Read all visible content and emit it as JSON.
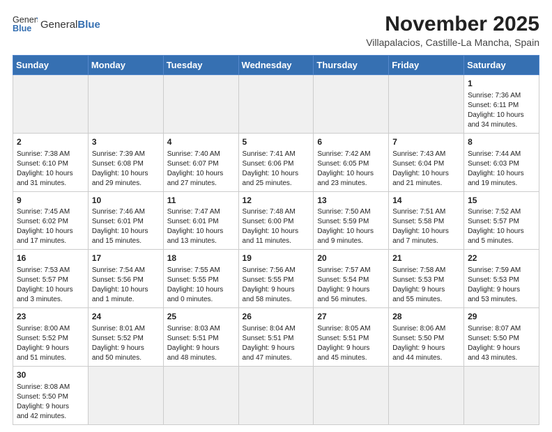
{
  "header": {
    "logo_general": "General",
    "logo_blue": "Blue",
    "month_title": "November 2025",
    "location": "Villapalacios, Castille-La Mancha, Spain"
  },
  "weekdays": [
    "Sunday",
    "Monday",
    "Tuesday",
    "Wednesday",
    "Thursday",
    "Friday",
    "Saturday"
  ],
  "weeks": [
    [
      {
        "day": "",
        "info": "",
        "empty": true
      },
      {
        "day": "",
        "info": "",
        "empty": true
      },
      {
        "day": "",
        "info": "",
        "empty": true
      },
      {
        "day": "",
        "info": "",
        "empty": true
      },
      {
        "day": "",
        "info": "",
        "empty": true
      },
      {
        "day": "",
        "info": "",
        "empty": true
      },
      {
        "day": "1",
        "info": "Sunrise: 7:36 AM\nSunset: 6:11 PM\nDaylight: 10 hours\nand 34 minutes."
      }
    ],
    [
      {
        "day": "2",
        "info": "Sunrise: 7:38 AM\nSunset: 6:10 PM\nDaylight: 10 hours\nand 31 minutes."
      },
      {
        "day": "3",
        "info": "Sunrise: 7:39 AM\nSunset: 6:08 PM\nDaylight: 10 hours\nand 29 minutes."
      },
      {
        "day": "4",
        "info": "Sunrise: 7:40 AM\nSunset: 6:07 PM\nDaylight: 10 hours\nand 27 minutes."
      },
      {
        "day": "5",
        "info": "Sunrise: 7:41 AM\nSunset: 6:06 PM\nDaylight: 10 hours\nand 25 minutes."
      },
      {
        "day": "6",
        "info": "Sunrise: 7:42 AM\nSunset: 6:05 PM\nDaylight: 10 hours\nand 23 minutes."
      },
      {
        "day": "7",
        "info": "Sunrise: 7:43 AM\nSunset: 6:04 PM\nDaylight: 10 hours\nand 21 minutes."
      },
      {
        "day": "8",
        "info": "Sunrise: 7:44 AM\nSunset: 6:03 PM\nDaylight: 10 hours\nand 19 minutes."
      }
    ],
    [
      {
        "day": "9",
        "info": "Sunrise: 7:45 AM\nSunset: 6:02 PM\nDaylight: 10 hours\nand 17 minutes."
      },
      {
        "day": "10",
        "info": "Sunrise: 7:46 AM\nSunset: 6:01 PM\nDaylight: 10 hours\nand 15 minutes."
      },
      {
        "day": "11",
        "info": "Sunrise: 7:47 AM\nSunset: 6:01 PM\nDaylight: 10 hours\nand 13 minutes."
      },
      {
        "day": "12",
        "info": "Sunrise: 7:48 AM\nSunset: 6:00 PM\nDaylight: 10 hours\nand 11 minutes."
      },
      {
        "day": "13",
        "info": "Sunrise: 7:50 AM\nSunset: 5:59 PM\nDaylight: 10 hours\nand 9 minutes."
      },
      {
        "day": "14",
        "info": "Sunrise: 7:51 AM\nSunset: 5:58 PM\nDaylight: 10 hours\nand 7 minutes."
      },
      {
        "day": "15",
        "info": "Sunrise: 7:52 AM\nSunset: 5:57 PM\nDaylight: 10 hours\nand 5 minutes."
      }
    ],
    [
      {
        "day": "16",
        "info": "Sunrise: 7:53 AM\nSunset: 5:57 PM\nDaylight: 10 hours\nand 3 minutes."
      },
      {
        "day": "17",
        "info": "Sunrise: 7:54 AM\nSunset: 5:56 PM\nDaylight: 10 hours\nand 1 minute."
      },
      {
        "day": "18",
        "info": "Sunrise: 7:55 AM\nSunset: 5:55 PM\nDaylight: 10 hours\nand 0 minutes."
      },
      {
        "day": "19",
        "info": "Sunrise: 7:56 AM\nSunset: 5:55 PM\nDaylight: 9 hours\nand 58 minutes."
      },
      {
        "day": "20",
        "info": "Sunrise: 7:57 AM\nSunset: 5:54 PM\nDaylight: 9 hours\nand 56 minutes."
      },
      {
        "day": "21",
        "info": "Sunrise: 7:58 AM\nSunset: 5:53 PM\nDaylight: 9 hours\nand 55 minutes."
      },
      {
        "day": "22",
        "info": "Sunrise: 7:59 AM\nSunset: 5:53 PM\nDaylight: 9 hours\nand 53 minutes."
      }
    ],
    [
      {
        "day": "23",
        "info": "Sunrise: 8:00 AM\nSunset: 5:52 PM\nDaylight: 9 hours\nand 51 minutes."
      },
      {
        "day": "24",
        "info": "Sunrise: 8:01 AM\nSunset: 5:52 PM\nDaylight: 9 hours\nand 50 minutes."
      },
      {
        "day": "25",
        "info": "Sunrise: 8:03 AM\nSunset: 5:51 PM\nDaylight: 9 hours\nand 48 minutes."
      },
      {
        "day": "26",
        "info": "Sunrise: 8:04 AM\nSunset: 5:51 PM\nDaylight: 9 hours\nand 47 minutes."
      },
      {
        "day": "27",
        "info": "Sunrise: 8:05 AM\nSunset: 5:51 PM\nDaylight: 9 hours\nand 45 minutes."
      },
      {
        "day": "28",
        "info": "Sunrise: 8:06 AM\nSunset: 5:50 PM\nDaylight: 9 hours\nand 44 minutes."
      },
      {
        "day": "29",
        "info": "Sunrise: 8:07 AM\nSunset: 5:50 PM\nDaylight: 9 hours\nand 43 minutes."
      }
    ],
    [
      {
        "day": "30",
        "info": "Sunrise: 8:08 AM\nSunset: 5:50 PM\nDaylight: 9 hours\nand 42 minutes."
      },
      {
        "day": "",
        "info": "",
        "empty": true
      },
      {
        "day": "",
        "info": "",
        "empty": true
      },
      {
        "day": "",
        "info": "",
        "empty": true
      },
      {
        "day": "",
        "info": "",
        "empty": true
      },
      {
        "day": "",
        "info": "",
        "empty": true
      },
      {
        "day": "",
        "info": "",
        "empty": true
      }
    ]
  ]
}
